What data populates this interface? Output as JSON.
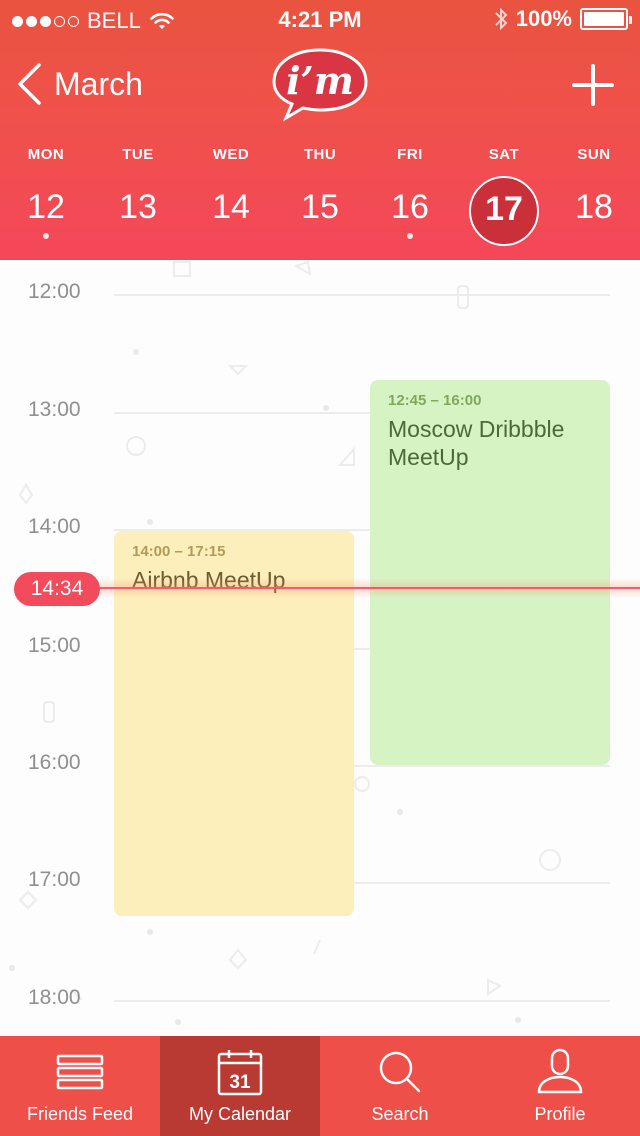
{
  "status_bar": {
    "carrier": "BELL",
    "time": "4:21 PM",
    "battery": "100%"
  },
  "nav": {
    "back_label": "March",
    "logo_text": "i’m"
  },
  "week": [
    {
      "name": "MON",
      "num": "12",
      "has_events": true,
      "selected": false
    },
    {
      "name": "TUE",
      "num": "13",
      "has_events": false,
      "selected": false
    },
    {
      "name": "WED",
      "num": "14",
      "has_events": false,
      "selected": false
    },
    {
      "name": "THU",
      "num": "15",
      "has_events": false,
      "selected": false
    },
    {
      "name": "FRI",
      "num": "16",
      "has_events": true,
      "selected": false
    },
    {
      "name": "SAT",
      "num": "17",
      "has_events": false,
      "selected": true
    },
    {
      "name": "SUN",
      "num": "18",
      "has_events": false,
      "selected": false
    }
  ],
  "hours": [
    "12:00",
    "13:00",
    "14:00",
    "15:00",
    "16:00",
    "17:00",
    "18:00"
  ],
  "events": {
    "airbnb": {
      "time": "14:00 – 17:15",
      "title": "Airbnb MeetUp"
    },
    "moscow": {
      "time": "12:45 – 16:00",
      "title": "Moscow Dribbble MeetUp"
    }
  },
  "current_time": "14:34",
  "tabs": [
    {
      "label": "Friends Feed",
      "icon": "list-icon",
      "active": false
    },
    {
      "label": "My Calendar",
      "icon": "calendar-icon",
      "active": true,
      "icon_text": "31"
    },
    {
      "label": "Search",
      "icon": "search-icon",
      "active": false
    },
    {
      "label": "Profile",
      "icon": "profile-icon",
      "active": false
    }
  ],
  "colors": {
    "header": "#f0514b",
    "selected_day": "#c9303a",
    "now_badge": "#f14b5c",
    "tab_bar": "#ee4f48",
    "tab_active": "#b93a33",
    "event_yellow": "#fcefbc",
    "event_green": "#d6f3c4"
  }
}
